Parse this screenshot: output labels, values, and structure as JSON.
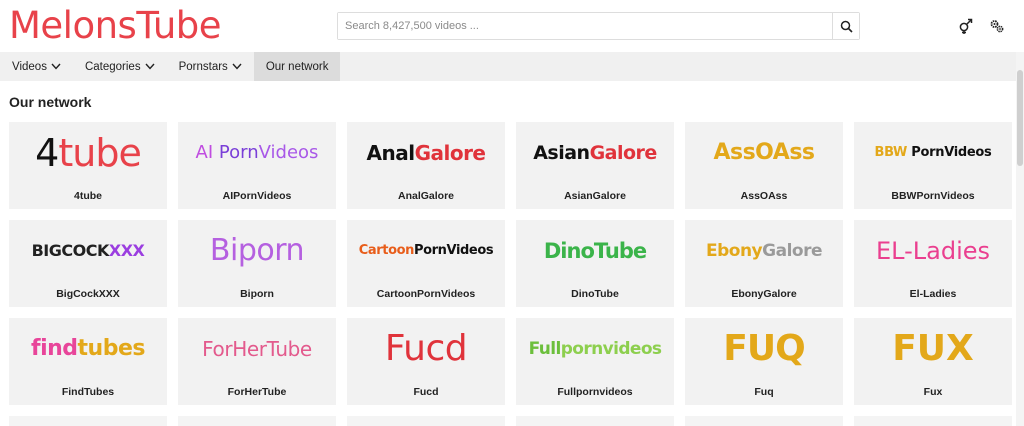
{
  "header": {
    "brand": "MelonsTube",
    "search_placeholder": "Search 8,427,500 videos ...",
    "search_icon": "search-icon",
    "gender_icon": "gender-icon",
    "settings_icon": "settings-gears-icon"
  },
  "nav": {
    "items": [
      {
        "label": "Videos",
        "has_dropdown": true
      },
      {
        "label": "Categories",
        "has_dropdown": true
      },
      {
        "label": "Pornstars",
        "has_dropdown": true
      },
      {
        "label": "Our network",
        "has_dropdown": false,
        "active": true
      }
    ]
  },
  "section": {
    "title": "Our network"
  },
  "sites": [
    {
      "name": "4tube",
      "logo": {
        "parts": [
          "4",
          "tube"
        ],
        "colors": [
          "#111111",
          "#e8424a"
        ]
      }
    },
    {
      "name": "AIPornVideos",
      "logo": {
        "parts": [
          "AI",
          " Porn",
          "Videos"
        ],
        "colors": [
          "#c04de0",
          "#7a3fd8",
          "#a858e8"
        ]
      }
    },
    {
      "name": "AnalGalore",
      "logo": {
        "parts": [
          "Anal",
          "Galore"
        ],
        "colors": [
          "#111111",
          "#e0333b"
        ]
      }
    },
    {
      "name": "AsianGalore",
      "logo": {
        "parts": [
          "Asian",
          "Galore"
        ],
        "colors": [
          "#111111",
          "#e0333b"
        ]
      }
    },
    {
      "name": "AssOAss",
      "logo": {
        "parts": [
          "AssOAss"
        ],
        "colors": [
          "#e3a81a"
        ]
      }
    },
    {
      "name": "BBWPornVideos",
      "logo": {
        "parts": [
          "BBW",
          " PornVideos"
        ],
        "colors": [
          "#e3a81a",
          "#111111"
        ]
      }
    },
    {
      "name": "BigCockXXX",
      "logo": {
        "parts": [
          "BIGCOCK",
          "XXX"
        ],
        "colors": [
          "#222222",
          "#9b3ee0"
        ]
      }
    },
    {
      "name": "Biporn",
      "logo": {
        "parts": [
          "Bi",
          "porn"
        ],
        "colors": [
          "#b560e0",
          "#b560e0"
        ]
      }
    },
    {
      "name": "CartoonPornVideos",
      "logo": {
        "parts": [
          "Cartoon",
          "PornVideos"
        ],
        "colors": [
          "#e85d1a",
          "#111111"
        ]
      }
    },
    {
      "name": "DinoTube",
      "logo": {
        "parts": [
          "DinoTube"
        ],
        "colors": [
          "#3bb44a"
        ]
      }
    },
    {
      "name": "EbonyGalore",
      "logo": {
        "parts": [
          "Ebony",
          "Galore"
        ],
        "colors": [
          "#e3a81a",
          "#9a9a9a"
        ]
      }
    },
    {
      "name": "El-Ladies",
      "logo": {
        "parts": [
          "EL-Ladies"
        ],
        "colors": [
          "#ea3f8f"
        ]
      }
    },
    {
      "name": "FindTubes",
      "logo": {
        "parts": [
          "find",
          "tubes"
        ],
        "colors": [
          "#e8459a",
          "#e3a81a"
        ]
      }
    },
    {
      "name": "ForHerTube",
      "logo": {
        "parts": [
          "ForHerTube"
        ],
        "colors": [
          "#e35a8d"
        ]
      }
    },
    {
      "name": "Fucd",
      "logo": {
        "parts": [
          "Fucd"
        ],
        "colors": [
          "#e0333b"
        ]
      }
    },
    {
      "name": "Fullpornvideos",
      "logo": {
        "parts": [
          "Full",
          "pornvideos"
        ],
        "colors": [
          "#6cbf3c",
          "#8dcf4e"
        ]
      }
    },
    {
      "name": "Fuq",
      "logo": {
        "parts": [
          "FUQ"
        ],
        "colors": [
          "#e3a81a"
        ]
      }
    },
    {
      "name": "Fux",
      "logo": {
        "parts": [
          "FUX"
        ],
        "colors": [
          "#e3a81a"
        ]
      }
    }
  ]
}
